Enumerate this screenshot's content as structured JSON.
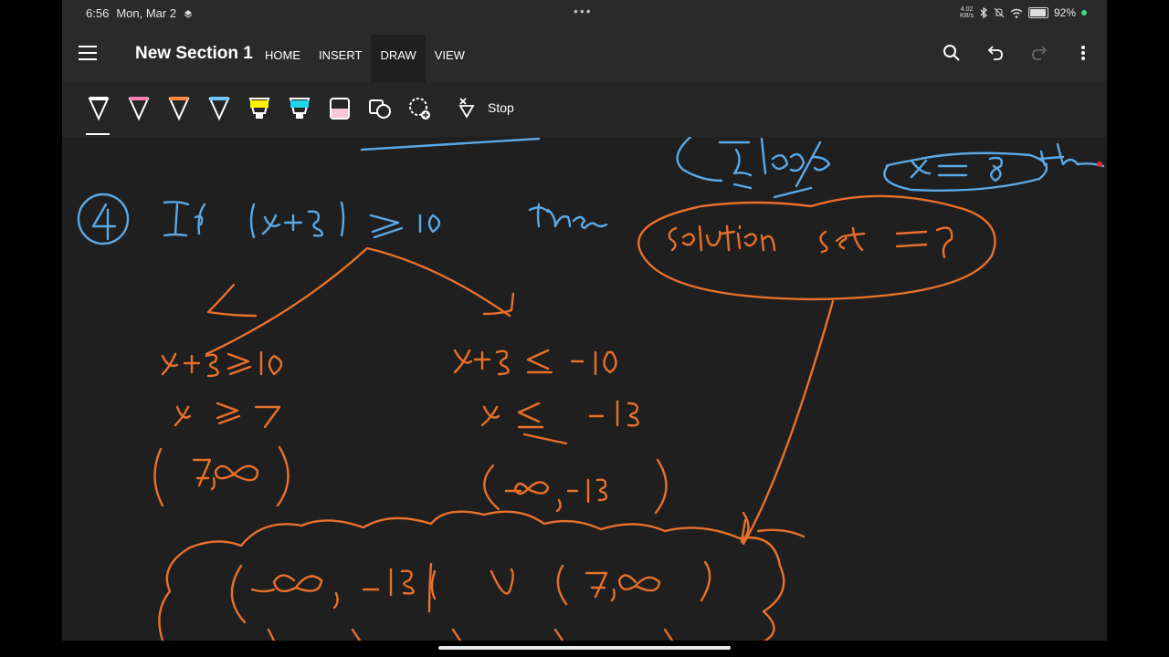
{
  "status": {
    "time": "6:56",
    "date": "Mon, Mar 2",
    "net_speed_value": "4.02",
    "net_speed_unit": "KB/s",
    "battery": "92%",
    "battery_level": 0.92,
    "dots": "•••"
  },
  "app": {
    "section_title": "New Section 1",
    "tabs": [
      {
        "label": "HOME"
      },
      {
        "label": "INSERT"
      },
      {
        "label": "DRAW"
      },
      {
        "label": "VIEW"
      }
    ],
    "active_tab": "DRAW"
  },
  "toolbar": {
    "pens": [
      {
        "name": "pen-white",
        "color": "#ffffff"
      },
      {
        "name": "pen-pink",
        "color": "#ff7eb3"
      },
      {
        "name": "pen-orange",
        "color": "#ff8a3d"
      },
      {
        "name": "pen-blue",
        "color": "#6ec6ff"
      },
      {
        "name": "highlighter-yellow",
        "color": "#fff200"
      },
      {
        "name": "highlighter-cyan",
        "color": "#22d3ee"
      },
      {
        "name": "highlighter-pink",
        "color": "#f9c6d8"
      }
    ],
    "stop_label": "Stop"
  },
  "colors": {
    "ink_blue": "#5aa9e6",
    "ink_orange": "#e8702a",
    "canvas_bg": "#1f1f1f"
  }
}
